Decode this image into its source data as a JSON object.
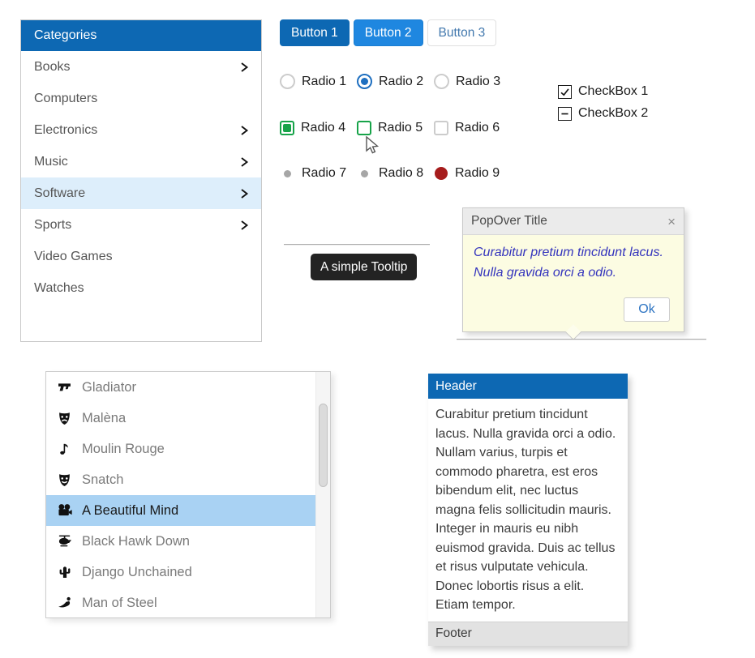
{
  "colors": {
    "primary_blue": "#0d68b3",
    "button2_blue": "#1f87e0",
    "selection_blue": "#a9d2f3",
    "category_selected_bg": "#ddeefb",
    "radio_checked_blue": "#1e6fc0",
    "radio_green": "#17a349",
    "radio_red": "#a61c1c",
    "popover_body_bg": "#fcfce2",
    "popover_text_blue": "#3434bd",
    "tooltip_bg": "#232323",
    "footer_gray": "#e2e2e2"
  },
  "categories": {
    "header": "Categories",
    "items": [
      {
        "label": "Books",
        "arrow": true,
        "selected": false
      },
      {
        "label": "Computers",
        "arrow": false,
        "selected": false
      },
      {
        "label": "Electronics",
        "arrow": true,
        "selected": false
      },
      {
        "label": "Music",
        "arrow": true,
        "selected": false
      },
      {
        "label": "Software",
        "arrow": true,
        "selected": true
      },
      {
        "label": "Sports",
        "arrow": true,
        "selected": false
      },
      {
        "label": "Video Games",
        "arrow": false,
        "selected": false
      },
      {
        "label": "Watches",
        "arrow": false,
        "selected": false
      }
    ]
  },
  "buttons": [
    {
      "label": "Button 1",
      "style": "primary-dark"
    },
    {
      "label": "Button 2",
      "style": "primary-light"
    },
    {
      "label": "Button 3",
      "style": "outline"
    }
  ],
  "radios": [
    {
      "label": "Radio 1",
      "state": "circle-unchecked"
    },
    {
      "label": "Radio 2",
      "state": "circle-checked-blue"
    },
    {
      "label": "Radio 3",
      "state": "circle-unchecked"
    },
    {
      "label": "Radio 4",
      "state": "square-green-checked"
    },
    {
      "label": "Radio 5",
      "state": "square-green-empty"
    },
    {
      "label": "Radio 6",
      "state": "square-gray-empty"
    },
    {
      "label": "Radio 7",
      "state": "small-gray-dot"
    },
    {
      "label": "Radio 8",
      "state": "small-gray-dot"
    },
    {
      "label": "Radio 9",
      "state": "red-dot"
    }
  ],
  "checkboxes": [
    {
      "label": "CheckBox 1",
      "state": "checked"
    },
    {
      "label": "CheckBox 2",
      "state": "indeterminate"
    }
  ],
  "tooltip": {
    "text": "A simple Tooltip"
  },
  "popover": {
    "title": "PopOver Title",
    "close_icon": "×",
    "body": "Curabitur pretium tincidunt lacus. Nulla gravida orci a odio.",
    "ok_label": "Ok"
  },
  "movies": {
    "items": [
      {
        "label": "Gladiator",
        "icon": "gun-icon",
        "selected": false
      },
      {
        "label": "Malèna",
        "icon": "sad-mask-icon",
        "selected": false
      },
      {
        "label": "Moulin Rouge",
        "icon": "music-note-icon",
        "selected": false
      },
      {
        "label": "Snatch",
        "icon": "happy-mask-icon",
        "selected": false
      },
      {
        "label": "A Beautiful Mind",
        "icon": "movie-camera-icon",
        "selected": true
      },
      {
        "label": "Black Hawk Down",
        "icon": "helicopter-icon",
        "selected": false
      },
      {
        "label": "Django Unchained",
        "icon": "cactus-icon",
        "selected": false
      },
      {
        "label": "Man of Steel",
        "icon": "superman-icon",
        "selected": false
      }
    ]
  },
  "panel": {
    "header": "Header",
    "body": "Curabitur pretium tincidunt lacus. Nulla gravida orci a odio. Nullam varius, turpis et commodo pharetra, est eros bibendum elit, nec luctus magna felis sollicitudin mauris. Integer in mauris eu nibh euismod gravida. Duis ac tellus et risus vulputate vehicula. Donec lobortis risus a elit. Etiam tempor.",
    "footer": "Footer"
  }
}
